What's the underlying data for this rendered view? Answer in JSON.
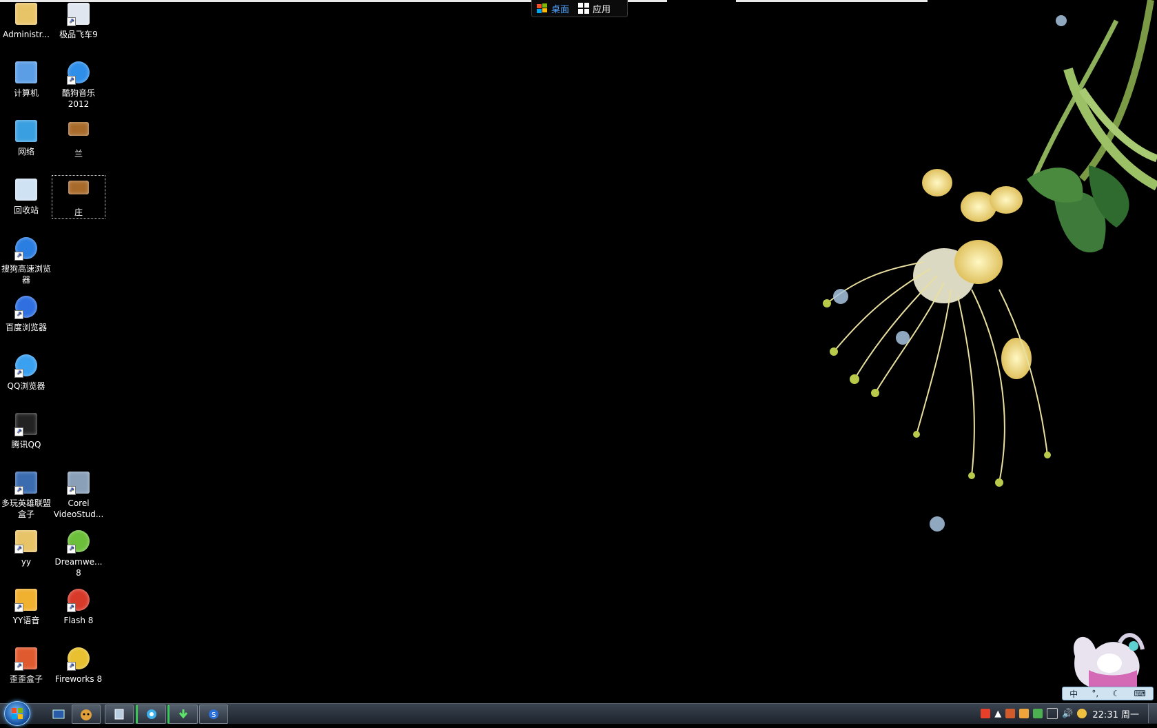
{
  "topbar": {
    "desktop_label": "桌面",
    "apps_label": "应用"
  },
  "desktop_icons": [
    {
      "label": "Administr...",
      "icon": "user-folder-icon"
    },
    {
      "label": "极品飞车9",
      "icon": "shortcut-doc-icon"
    },
    {
      "label": "计算机",
      "icon": "computer-icon"
    },
    {
      "label": "酷狗音乐\n2012",
      "icon": "kugou-icon"
    },
    {
      "label": "网络",
      "icon": "network-icon"
    },
    {
      "label": "兰",
      "icon": "image-thumb-icon"
    },
    {
      "label": "回收站",
      "icon": "recycle-bin-icon"
    },
    {
      "label": "庄",
      "icon": "image-thumb-icon"
    },
    {
      "label": "搜狗高速浏览\n器",
      "icon": "sogou-browser-icon"
    },
    {
      "label": "百度浏览器",
      "icon": "baidu-browser-icon"
    },
    {
      "label": "QQ浏览器",
      "icon": "qq-browser-icon"
    },
    {
      "label": "腾讯QQ",
      "icon": "qq-penguin-icon"
    },
    {
      "label": "多玩英雄联盟\n盒子",
      "icon": "duowan-box-icon"
    },
    {
      "label": "Corel\nVideoStud...",
      "icon": "corel-video-icon"
    },
    {
      "label": "yy",
      "icon": "folder-shortcut-icon"
    },
    {
      "label": "Dreamwe...\n8",
      "icon": "dreamweaver-icon"
    },
    {
      "label": "YY语音",
      "icon": "yy-voice-icon"
    },
    {
      "label": "Flash 8",
      "icon": "flash-icon"
    },
    {
      "label": "歪歪盒子",
      "icon": "yy-box-icon"
    },
    {
      "label": "Fireworks 8",
      "icon": "fireworks-icon"
    }
  ],
  "ime": {
    "mode_label": "中"
  },
  "taskbar": {
    "clock": "22:31 周一",
    "buttons": [
      "start-icon",
      "window-switch-icon",
      "cat-app-icon",
      "notepad-icon",
      "browser-icon",
      "download-icon",
      "sogou-icon"
    ]
  },
  "colors": {
    "desktop_bg": "#000000",
    "accent": "#4fa3ff"
  }
}
